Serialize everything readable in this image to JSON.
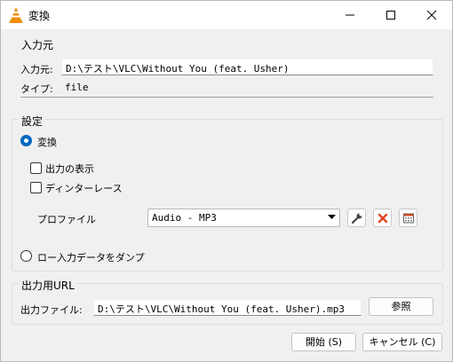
{
  "window": {
    "title": "変換"
  },
  "source": {
    "group_title": "入力元",
    "source_label": "入力元:",
    "source_value": "D:\\テスト\\VLC\\Without You (feat. Usher)",
    "type_label": "タイプ:",
    "type_value": "file"
  },
  "settings": {
    "group_title": "設定",
    "convert_label": "変換",
    "convert_selected": true,
    "show_output_label": "出力の表示",
    "show_output_checked": false,
    "deinterlace_label": "ディンターレース",
    "deinterlace_checked": false,
    "profile_label": "プロファイル",
    "profile_value": "Audio - MP3",
    "dump_raw_label": "ロー入力データをダンプ",
    "dump_raw_selected": false
  },
  "destination": {
    "group_title": "出力用URL",
    "file_label": "出力ファイル:",
    "file_value": "D:\\テスト\\VLC\\Without You (feat. Usher).mp3",
    "browse_label": "参照"
  },
  "actions": {
    "start_label": "開始 (S)",
    "cancel_label": "キャンセル (C)"
  },
  "colors": {
    "accent": "#0067c0",
    "delete_icon": "#e0451f",
    "vlc_cone": "#f08c00"
  }
}
